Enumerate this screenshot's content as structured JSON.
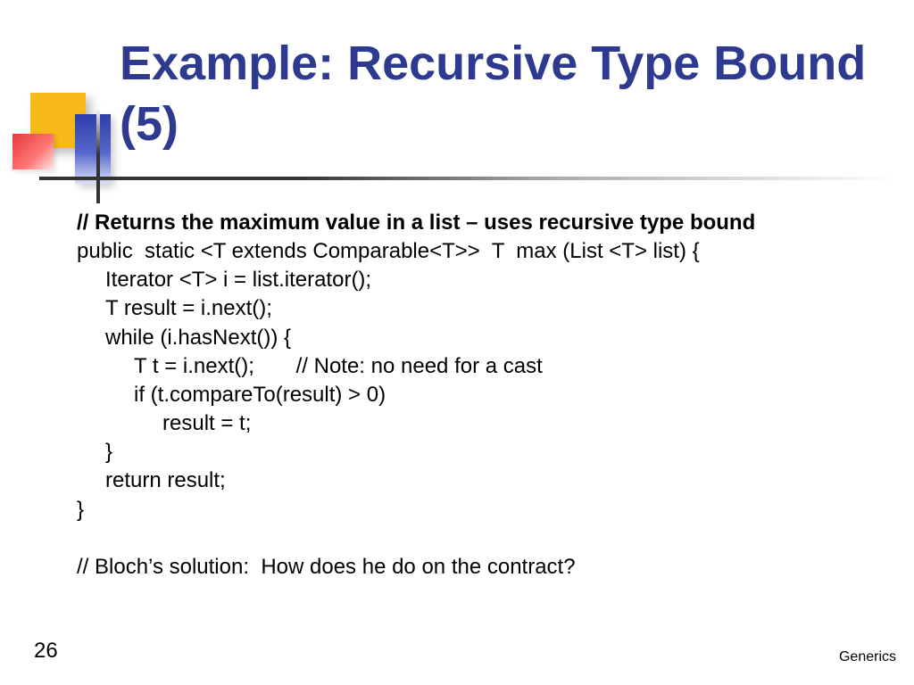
{
  "title": "Example: Recursive Type Bound (5)",
  "code": {
    "c0": "// Returns the maximum value in a list – uses recursive type bound",
    "c1": "public  static <T extends Comparable<T>>  T  max (List <T> list) {",
    "c2": "Iterator <T> i = list.iterator();",
    "c3": "T result = i.next();",
    "c4": "while (i.hasNext()) {",
    "c5": "T t = i.next();       // Note: no need for a cast",
    "c6": "if (t.compareTo(result) > 0)",
    "c7": "result = t;",
    "c8": "}",
    "c9": "return result;",
    "c10": "}",
    "c11": "// Bloch’s solution:  How does he do on the contract?"
  },
  "page_number": "26",
  "footer": "Generics"
}
